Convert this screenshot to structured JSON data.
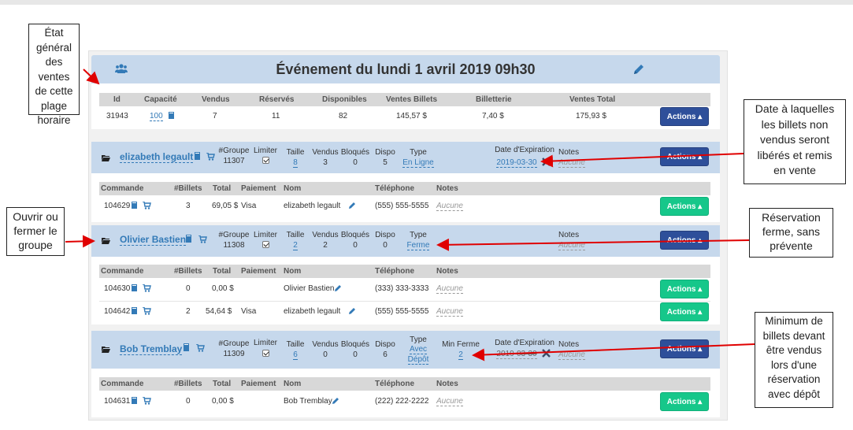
{
  "event": {
    "title": "Événement du lundi 1 avril 2019 09h30",
    "headers": [
      "Id",
      "Capacité",
      "Vendus",
      "Réservés",
      "Disponibles",
      "Ventes Billets",
      "Billetterie",
      "Ventes Total"
    ],
    "values": {
      "id": "31943",
      "capacite": "100",
      "vendus": "7",
      "reserves": "11",
      "disponibles": "82",
      "ventes_billets": "145,57 $",
      "billetterie": "7,40 $",
      "ventes_total": "175,93 $"
    },
    "actions_label": "Actions ▴"
  },
  "group_labels": {
    "groupe": "#Groupe",
    "limiter": "Limiter",
    "taille": "Taille",
    "vendus": "Vendus",
    "bloques": "Bloqués",
    "dispo": "Dispo",
    "type": "Type",
    "min_ferme": "Min Ferme",
    "date_exp": "Date d'Expiration",
    "notes": "Notes"
  },
  "order_headers": [
    "Commande",
    "#Billets",
    "Total",
    "Paiement",
    "Nom",
    "Téléphone",
    "Notes"
  ],
  "groups": [
    {
      "name": "elizabeth legault",
      "groupe": "11307",
      "taille": "8",
      "vendus": "3",
      "bloques": "0",
      "dispo": "5",
      "type": "En Ligne",
      "date_exp": "2019-03-30",
      "notes": "Aucune",
      "actions_label": "Actions ▴",
      "orders": [
        {
          "commande": "104629",
          "billets": "3",
          "total": "69,05 $",
          "paiement": "Visa",
          "nom": "elizabeth legault",
          "telephone": "(555) 555-5555",
          "notes": "Aucune",
          "actions_label": "Actions ▴"
        }
      ]
    },
    {
      "name": "Olivier Bastien",
      "groupe": "11308",
      "taille": "2",
      "vendus": "2",
      "bloques": "0",
      "dispo": "0",
      "type": "Ferme",
      "notes": "Aucune",
      "actions_label": "Actions ▴",
      "orders": [
        {
          "commande": "104630",
          "billets": "0",
          "total": "0,00 $",
          "paiement": "",
          "nom": "Olivier Bastien",
          "telephone": "(333) 333-3333",
          "notes": "Aucune",
          "actions_label": "Actions ▴"
        },
        {
          "commande": "104642",
          "billets": "2",
          "total": "54,64 $",
          "paiement": "Visa",
          "nom": "elizabeth legault",
          "telephone": "(555) 555-5555",
          "notes": "Aucune",
          "actions_label": "Actions ▴"
        }
      ]
    },
    {
      "name": "Bob Tremblay",
      "groupe": "11309",
      "taille": "6",
      "vendus": "0",
      "bloques": "0",
      "dispo": "6",
      "type_line1": "Avec",
      "type_line2": "Dépôt",
      "min_ferme": "2",
      "date_exp": "2019-03-30",
      "notes": "Aucune",
      "actions_label": "Actions ▴",
      "orders": [
        {
          "commande": "104631",
          "billets": "0",
          "total": "0,00 $",
          "paiement": "",
          "nom": "Bob Tremblay",
          "telephone": "(222) 222-2222",
          "notes": "Aucune",
          "actions_label": "Actions ▴"
        }
      ]
    }
  ],
  "callouts": {
    "etat": [
      "État",
      "général",
      "des ventes",
      "de cette",
      "plage",
      "horaire"
    ],
    "date": [
      "Date à laquelles",
      "les billets non",
      "vendus seront",
      "libérés et remis",
      "en vente"
    ],
    "ouvrir": [
      "Ouvrir ou",
      "fermer le",
      "groupe"
    ],
    "ferme": [
      "Réservation",
      "ferme, sans",
      "prévente"
    ],
    "minimum": [
      "Minimum de",
      "billets devant",
      "être vendus",
      "lors d'une",
      "réservation",
      "avec dépôt"
    ]
  },
  "colors": {
    "panel_header": "#c6d8ec",
    "actions_blue": "#2e4f9a",
    "actions_green": "#16c78a",
    "link": "#337ab7",
    "arrow": "#e00000"
  }
}
